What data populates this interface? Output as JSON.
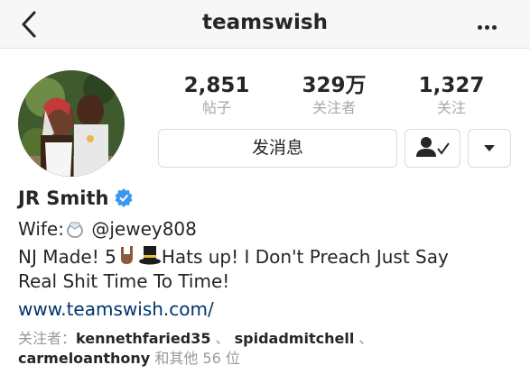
{
  "header": {
    "title": "teamswish",
    "back_icon": "chevron-left-icon",
    "more_icon": "more-horizontal-icon"
  },
  "stats": [
    {
      "value": "2,851",
      "label": "帖子"
    },
    {
      "value": "329万",
      "label": "关注者"
    },
    {
      "value": "1,327",
      "label": "关注"
    }
  ],
  "actions": {
    "message_label": "发消息",
    "following_icon": "person-check-icon",
    "dropdown_icon": "triangle-down-icon"
  },
  "profile": {
    "name": "JR Smith",
    "verified_icon": "verified-badge-icon",
    "bio_wife_label": "Wife:",
    "bio_wife_handle": "@jewey808",
    "bio_line2_a": "NJ Made! 5",
    "bio_line2_b": "Hats up! I Don't Preach Just Say",
    "bio_line3": "Real Shit Time To Time!",
    "website": "www.teamswish.com/"
  },
  "followed_by": {
    "prefix": "关注者：",
    "users": [
      "kennethfaried35",
      "spidadmitchell",
      "carmeloanthony"
    ],
    "separator": " 、",
    "suffix": "和其他 56 位"
  },
  "colors": {
    "accent_link": "#003569",
    "verified_blue": "#3897f0",
    "muted_text": "#999999"
  }
}
